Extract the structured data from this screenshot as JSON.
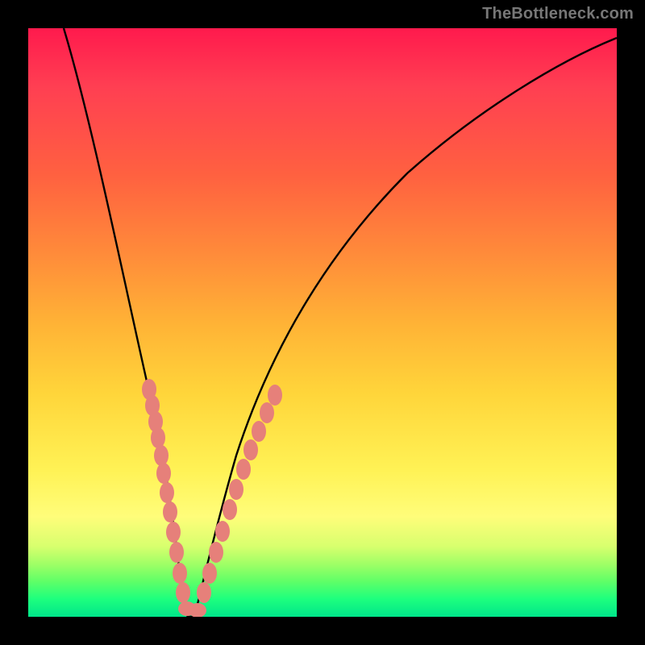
{
  "watermark": "TheBottleneck.com",
  "chart_data": {
    "type": "line",
    "title": "",
    "xlabel": "",
    "ylabel": "",
    "xlim": [
      0,
      100
    ],
    "ylim": [
      0,
      100
    ],
    "background_gradient": {
      "top_color": "#ff1a4d",
      "mid_color": "#ffd53a",
      "bottom_color": "#00e58a",
      "meaning": "red=high bottleneck, green=low bottleneck"
    },
    "series": [
      {
        "name": "bottleneck-curve",
        "note": "V-shaped curve; minimum near x≈26,y≈0; left branch steep, right branch shallow",
        "x": [
          6,
          10,
          14,
          18,
          20,
          22,
          24,
          25,
          26,
          27,
          28,
          30,
          32,
          36,
          40,
          46,
          54,
          64,
          76,
          90,
          100
        ],
        "y": [
          100,
          82,
          64,
          44,
          34,
          24,
          12,
          4,
          0,
          0,
          5,
          13,
          20,
          31,
          40,
          50,
          60,
          69,
          77,
          84,
          88
        ]
      },
      {
        "name": "data-point-markers",
        "note": "salmon pill markers clustered on lower arms of the V",
        "x": [
          18,
          19,
          20,
          20.5,
          21,
          22,
          23,
          23.5,
          24,
          24.5,
          25,
          25.5,
          26,
          26.5,
          27,
          27.5,
          28,
          29,
          30,
          31,
          32,
          33,
          34
        ],
        "y": [
          44,
          40,
          35,
          32,
          29,
          25,
          20,
          16,
          13,
          9,
          5,
          2,
          0,
          0,
          0,
          2,
          6,
          12,
          17,
          22,
          27,
          32,
          37
        ]
      }
    ]
  },
  "colors": {
    "curve": "#000000",
    "marker": "#e6807a",
    "frame": "#000000",
    "watermark": "#777777"
  }
}
